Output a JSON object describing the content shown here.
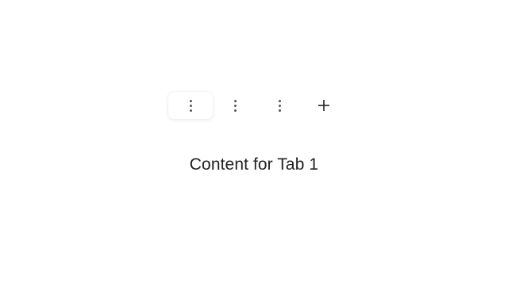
{
  "tabs": [
    {
      "icon": "kebab-menu-icon",
      "active": true
    },
    {
      "icon": "kebab-menu-icon",
      "active": false
    },
    {
      "icon": "kebab-menu-icon",
      "active": false
    }
  ],
  "add_tab": {
    "icon": "plus-icon"
  },
  "content": {
    "text": "Content for Tab 1"
  },
  "colors": {
    "icon": "#555555",
    "text": "#222222",
    "background": "#ffffff"
  }
}
